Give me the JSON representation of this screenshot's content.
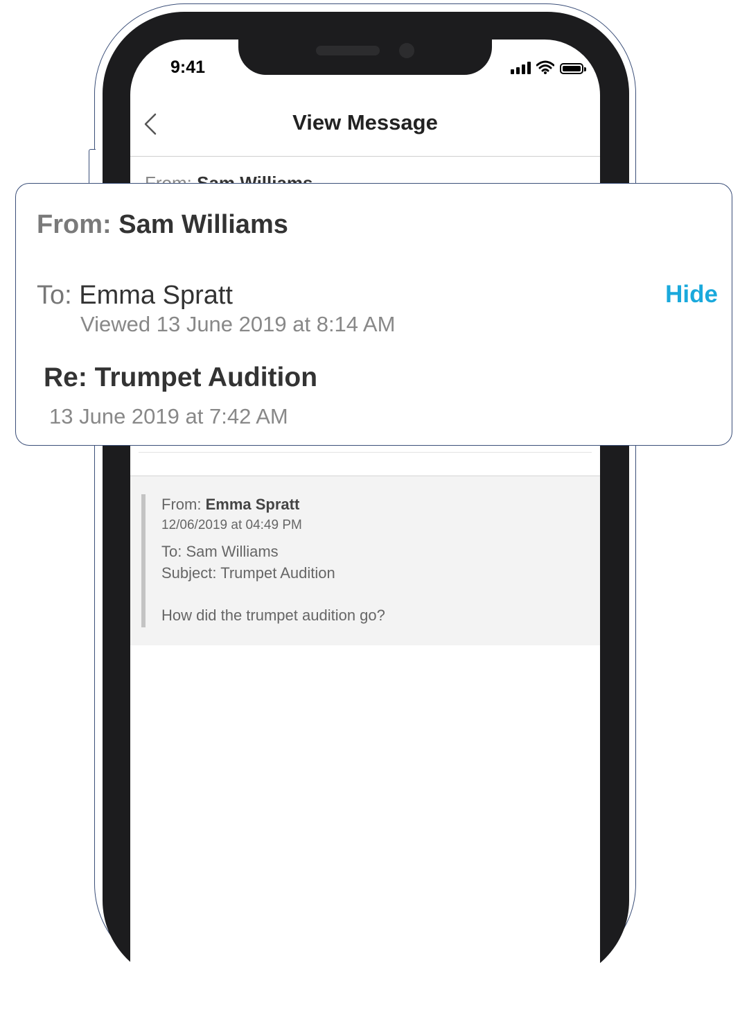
{
  "status_bar": {
    "time": "9:41"
  },
  "nav": {
    "title": "View Message"
  },
  "partial_header": {
    "from_label": "From:",
    "from_name": "Sam Williams"
  },
  "card": {
    "from_label": "From:",
    "from_name": "Sam Williams",
    "to_label": "To:",
    "to_name": "Emma Spratt",
    "hide_label": "Hide",
    "viewed": "Viewed 13 June 2019 at 8:14 AM",
    "subject": "Re: Trumpet Audition",
    "date": "13 June 2019 at 7:42 AM"
  },
  "quoted": {
    "from_label": "From:",
    "from_name": "Emma Spratt",
    "date": "12/06/2019 at 04:49 PM",
    "to": "To: Sam Williams",
    "subject": "Subject: Trumpet Audition",
    "body": "How did the trumpet audition go?"
  },
  "colors": {
    "accent": "#1aa9dc",
    "frame": "#1c1c1e",
    "outline": "#3a4e78"
  }
}
